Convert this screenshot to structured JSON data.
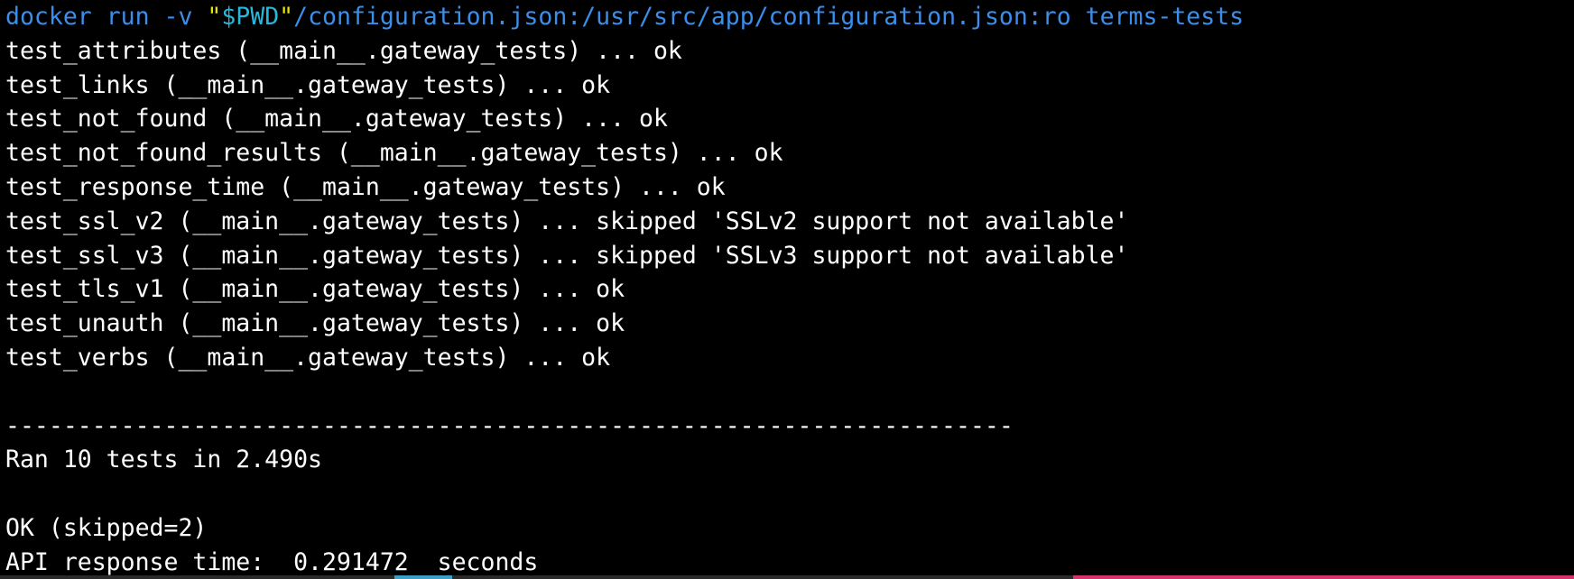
{
  "command": {
    "program": "docker",
    "args_before_quote": " run -v ",
    "quote_open": "\"",
    "variable": "$PWD",
    "quote_close": "\"",
    "args_after_quote": "/configuration.json:/usr/src/app/configuration.json:ro terms-tests"
  },
  "test_results": [
    {
      "text": "test_attributes (__main__.gateway_tests) ... ok"
    },
    {
      "text": "test_links (__main__.gateway_tests) ... ok"
    },
    {
      "text": "test_not_found (__main__.gateway_tests) ... ok"
    },
    {
      "text": "test_not_found_results (__main__.gateway_tests) ... ok"
    },
    {
      "text": "test_response_time (__main__.gateway_tests) ... ok"
    },
    {
      "text": "test_ssl_v2 (__main__.gateway_tests) ... skipped 'SSLv2 support not available'"
    },
    {
      "text": "test_ssl_v3 (__main__.gateway_tests) ... skipped 'SSLv3 support not available'"
    },
    {
      "text": "test_tls_v1 (__main__.gateway_tests) ... ok"
    },
    {
      "text": "test_unauth (__main__.gateway_tests) ... ok"
    },
    {
      "text": "test_verbs (__main__.gateway_tests) ... ok"
    }
  ],
  "separator": "----------------------------------------------------------------------",
  "summary": {
    "ran": "Ran 10 tests in 2.490s",
    "status": "OK (skipped=2)",
    "response_time": "API response time:  0.291472  seconds"
  },
  "colors": {
    "background": "#000000",
    "text": "#ffffff",
    "command": "#3b8eea",
    "quote": "#e5e510",
    "variable": "#29b8db"
  }
}
